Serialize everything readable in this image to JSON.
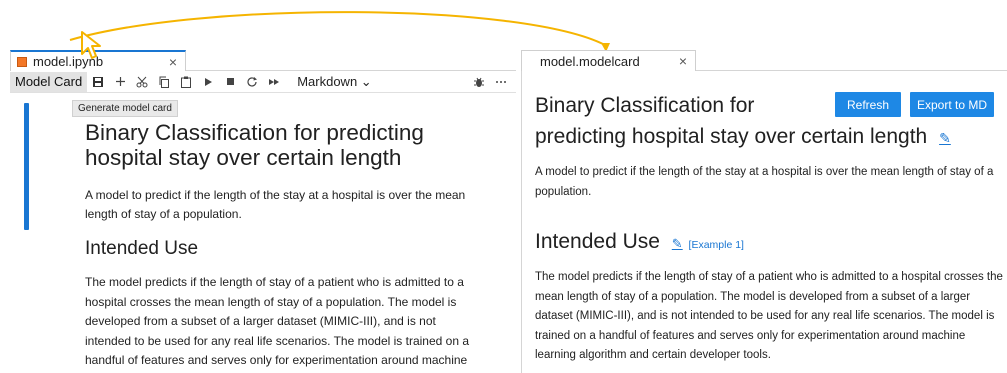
{
  "notebook": {
    "tab_title": "model.ipynb",
    "toolbar": {
      "model_card_label": "Model Card",
      "cell_type": "Markdown",
      "cell_type_chevron": "⌄",
      "icons": [
        "save-icon",
        "add-icon",
        "cut-icon",
        "copy-icon",
        "paste-icon",
        "run-icon",
        "stop-icon",
        "restart-icon",
        "run-all-icon",
        "bug-icon",
        "more-icon"
      ]
    },
    "tooltip": "Generate model card",
    "title": "Binary Classification for predicting hospital stay over certain length",
    "description": "A model to predict if the length of the stay at a hospital is over the mean length of stay of a population.",
    "section_heading": "Intended Use",
    "section_text": "The model predicts if the length of stay of a patient who is admitted to a hospital crosses the mean length of stay of a population. The model is developed from a subset of a larger dataset (MIMIC-III), and is not intended to be used for any real life scenarios. The model is trained on a handful of features and serves only for experimentation around machine learning algorithm and certain developer tools."
  },
  "model_card": {
    "tab_title": "model.modelcard",
    "title_line1": "Binary Classification for",
    "title_line2": "predicting hospital stay over certain length",
    "refresh_label": "Refresh",
    "export_label": "Export to MD",
    "description": "A model to predict if the length of the stay at a hospital is over the mean length of stay of a population.",
    "section_heading": "Intended Use",
    "section_example": "[Example 1]",
    "section_text": "The model predicts if the length of stay of a patient who is admitted to a hospital crosses the mean length of stay of a population. The model is developed from a subset of a larger dataset (MIMIC-III), and is not intended to be used for any real life scenarios. The model is trained on a handful of features and serves only for experimentation around machine learning algorithm and certain developer tools."
  },
  "close_glyph": "×",
  "colors": {
    "accent": "#1976d2",
    "button": "#1e88e5",
    "connector": "#f5b400"
  }
}
